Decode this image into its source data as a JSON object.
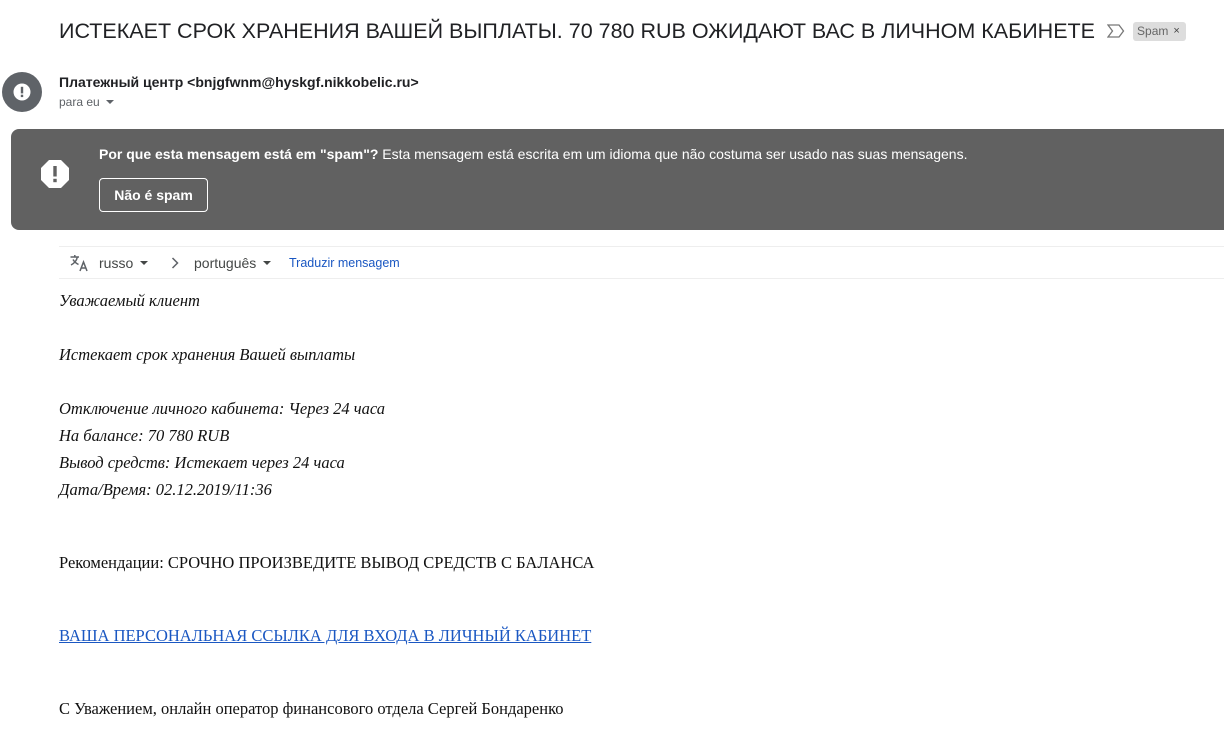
{
  "email": {
    "subject": "ИСТЕКАЕТ СРОК ХРАНЕНИЯ ВАШЕЙ ВЫПЛАТЫ. 70 780 RUB ОЖИДАЮТ ВАС В ЛИЧНОМ КАБИНЕТЕ",
    "label_chip": "Spam",
    "label_remove": "×",
    "sender": "Платежный центр <bnjgfwnm@hyskgf.nikkobelic.ru>",
    "recipient": "para eu"
  },
  "spam_banner": {
    "question": "Por que esta mensagem está em \"spam\"?",
    "explanation": " Esta mensagem está escrita em um idioma que não costuma ser usado nas suas mensagens.",
    "button_label": "Não é spam"
  },
  "translate_bar": {
    "source_language": "russo",
    "target_language": "português",
    "translate_link": "Traduzir mensagem"
  },
  "body": {
    "greeting": "Уважаемый клиент",
    "notice": "Истекает срок хранения Вашей выплаты",
    "details": [
      "Отключение личного кабинета: Через 24 часа",
      "На балансе: 70 780 RUB",
      "Вывод средств: Истекает через 24 часа",
      "Дата/Время: 02.12.2019/11:36"
    ],
    "recommendation": "Рекомендации: СРОЧНО ПРОИЗВЕДИТЕ ВЫВОД СРЕДСТВ С БАЛАНСА",
    "link_text": "ВАША ПЕРСОНАЛЬНАЯ ССЫЛКА ДЛЯ ВХОДА В ЛИЧНЫЙ КАБИНЕТ",
    "signature": "С Уважением,  онлайн оператор  финансового отдела Сергей Бондаренко"
  },
  "colors": {
    "banner_bg": "#616161",
    "link": "#1a57c2",
    "avatar_bg": "#5f6368"
  },
  "icons": {
    "avatar": "warning-circle-icon",
    "importance": "importance-marker-icon",
    "banner": "warning-octagon-icon",
    "translate": "translate-icon",
    "arrow": "chevron-right-icon"
  }
}
